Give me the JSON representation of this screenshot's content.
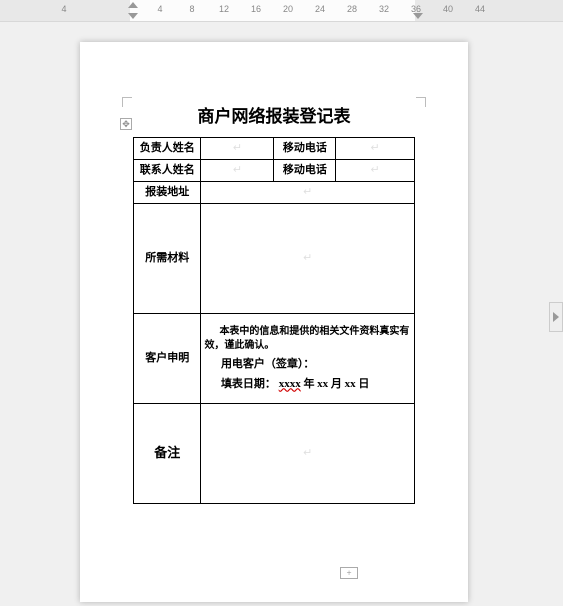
{
  "ruler": {
    "numbers_left": [
      "4"
    ],
    "numbers_main": [
      "4",
      "8",
      "12",
      "16",
      "20",
      "24",
      "28",
      "32",
      "36"
    ],
    "numbers_right": [
      "40",
      "44"
    ]
  },
  "document": {
    "title": "商户网络报装登记表",
    "rows": {
      "r1": {
        "label_a": "负责人姓名",
        "value_a": "",
        "label_b": "移动电话",
        "value_b": ""
      },
      "r2": {
        "label_a": "联系人姓名",
        "value_a": "",
        "label_b": "移动电话",
        "value_b": ""
      },
      "r3": {
        "label": "报装地址",
        "value": ""
      },
      "r4": {
        "label": "所需材料",
        "value": ""
      },
      "r5": {
        "label": "客户申明",
        "line1": "本表中的信息和提供的相关文件资料真实有效，谨此确认。",
        "line2_pre": "用电客户（签章）：",
        "line3_pre": "填表日期：",
        "line3_date_a": "xxxx",
        "line3_date_txt1": " 年 xx 月 xx 日"
      },
      "r6": {
        "label": "备注",
        "value": ""
      }
    }
  }
}
